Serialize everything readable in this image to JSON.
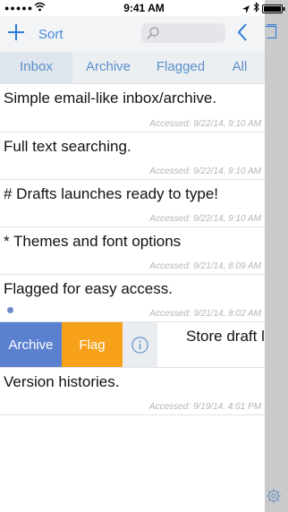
{
  "status": {
    "time": "9:41 AM",
    "signal": "●●●●●"
  },
  "toolbar": {
    "sort_label": "Sort"
  },
  "tabs": [
    {
      "label": "Inbox",
      "active": true
    },
    {
      "label": "Archive",
      "active": false
    },
    {
      "label": "Flagged",
      "active": false
    },
    {
      "label": "All",
      "active": false
    }
  ],
  "drafts": [
    {
      "title": "Simple email-like inbox/archive.",
      "accessed": "Accessed: 9/22/14, 9:10 AM"
    },
    {
      "title": "Full text searching.",
      "accessed": "Accessed: 9/22/14, 9:10 AM"
    },
    {
      "title": "# Drafts launches ready to type!",
      "accessed": "Accessed: 9/22/14, 9:10 AM"
    },
    {
      "title": "* Themes and font options",
      "accessed": "Accessed: 9/21/14, 8:09 AM"
    },
    {
      "title": "Flagged for easy access.",
      "accessed": "Accessed: 9/21/14, 8:02 AM"
    },
    {
      "title": "Version histories.",
      "accessed": "Accessed: 9/19/14, 4:01 PM"
    }
  ],
  "swiped_row": {
    "title": "Store draft loc",
    "archive_label": "Archive",
    "flag_label": "Flag"
  },
  "colors": {
    "accent": "#2f7bd6",
    "archive": "#5b80cf",
    "flag": "#f7a11a",
    "sidebar": "#c9cacc"
  },
  "icons": [
    "plus-icon",
    "search-icon",
    "back-chevron-icon",
    "sidebar-toggle-icon",
    "info-icon",
    "gear-icon",
    "flag-dot-icon",
    "wifi-icon",
    "location-icon",
    "bluetooth-icon",
    "battery-icon"
  ]
}
